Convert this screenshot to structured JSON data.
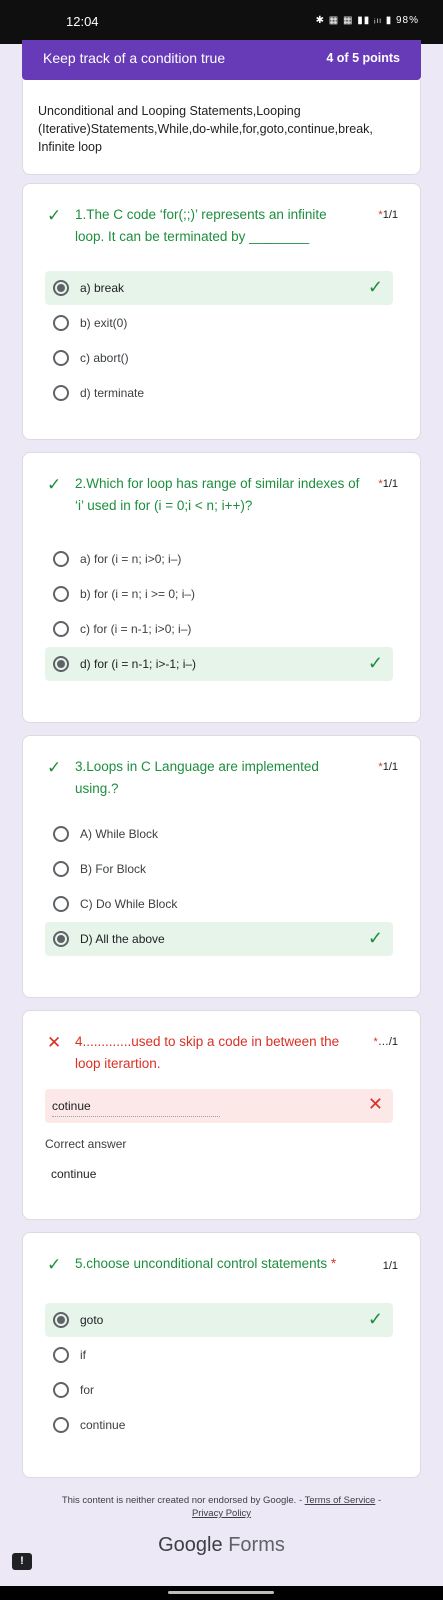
{
  "status": {
    "time": "12:04",
    "icons": "✱ ▦ ▦ ▮▮ ᵢₗₗ ▮ 98%",
    "battery": "98%"
  },
  "score_bar": {
    "title": "Keep track of a condition true",
    "score": "4 of 5 points"
  },
  "description": "Unconditional and Looping Statements,Looping (Iterative)Statements,While,do-while,for,goto,continue,break, Infinite loop",
  "questions": [
    {
      "title": "1.The C code ‘for(;;)’ represents an infinite loop. It can be terminated by ________",
      "score": "1/1",
      "options": [
        "a) break",
        "b) exit(0)",
        "c) abort()",
        "d) terminate"
      ],
      "selected": 0
    },
    {
      "title": "2.Which for loop has range of similar indexes of ‘i’ used in for (i = 0;i < n; i++)?",
      "score": "1/1",
      "options": [
        "a) for (i = n; i>0; i–)",
        "b) for (i = n; i >= 0; i–)",
        "c) for (i = n-1; i>0; i–)",
        "d) for (i = n-1; i>-1; i–)"
      ],
      "selected": 3
    },
    {
      "title": "3.Loops in C Language are implemented using.?",
      "score": "1/1",
      "options": [
        "A) While Block",
        "B) For Block",
        "C) Do While Block",
        "D) All the above"
      ],
      "selected": 3
    },
    {
      "title": "4.............used to skip a code in between the loop iterartion.",
      "score": "…/1",
      "answer": "cotinue",
      "correct_label": "Correct answer",
      "correct_value": "continue"
    },
    {
      "title": "5.choose unconditional control statements",
      "score": "1/1",
      "options": [
        "goto",
        "if",
        "for",
        "continue"
      ],
      "selected": 0
    }
  ],
  "required_mark": "*",
  "icons": {
    "correct": "check-icon",
    "wrong": "close-icon"
  },
  "colors": {
    "accent": "#673ab7",
    "correct": "#1e8e3e",
    "wrong": "#d93025",
    "correct_bg": "#e6f4ea",
    "wrong_bg": "#fce8e6"
  },
  "footer": {
    "note": "This content is neither created nor endorsed by Google. -",
    "terms": "Terms of Service",
    "privacy": "Privacy Policy",
    "brand_google": "Google",
    "brand_forms": "Forms"
  },
  "feedback_label": "!"
}
